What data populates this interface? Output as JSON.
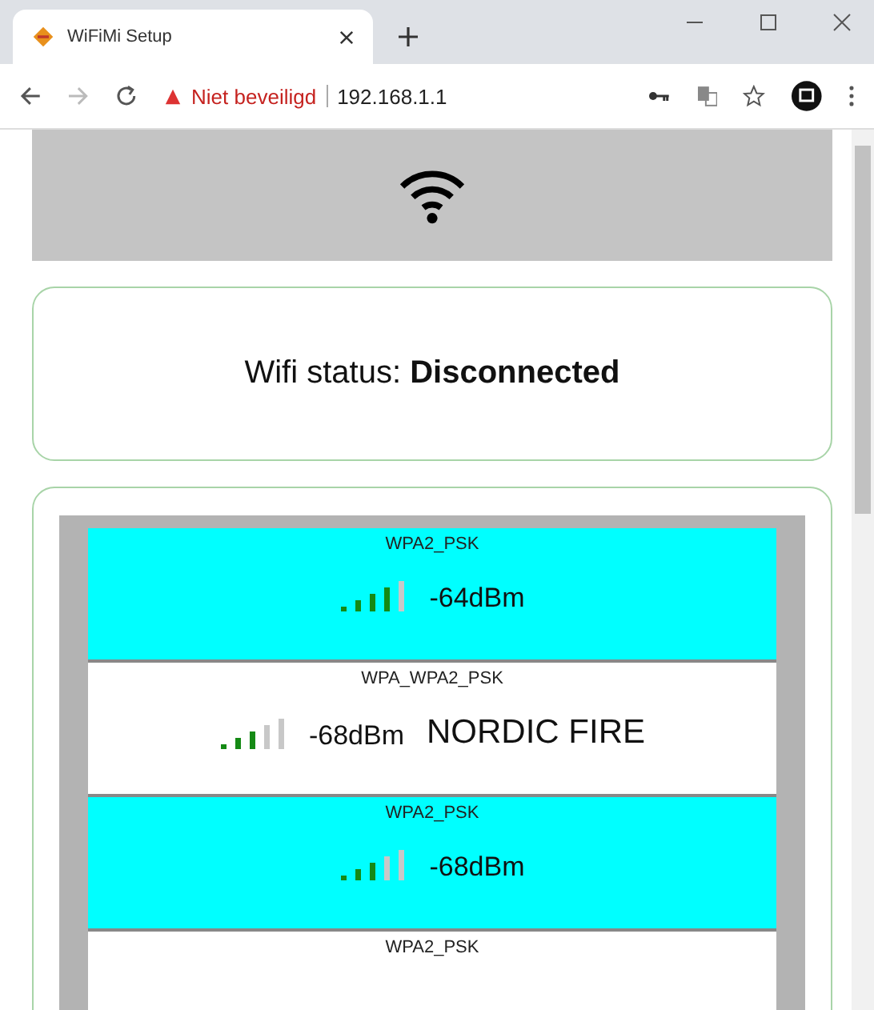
{
  "browser": {
    "tab_title": "WiFiMi Setup",
    "security_label": "Niet beveiligd",
    "url": "192.168.1.1"
  },
  "status": {
    "label": "Wifi status:",
    "value": "Disconnected"
  },
  "networks": [
    {
      "security": "WPA2_PSK",
      "level": 0.8,
      "rssi": "-64dBm",
      "selected": true
    },
    {
      "security": "WPA_WPA2_PSK",
      "level": 0.6,
      "rssi": "-68dBm",
      "ssid": "NORDIC FIRE",
      "selected": false
    },
    {
      "security": "WPA2_PSK",
      "level": 0.6,
      "rssi": "-68dBm",
      "selected": true
    },
    {
      "security": "WPA2_PSK",
      "selected": false
    }
  ]
}
